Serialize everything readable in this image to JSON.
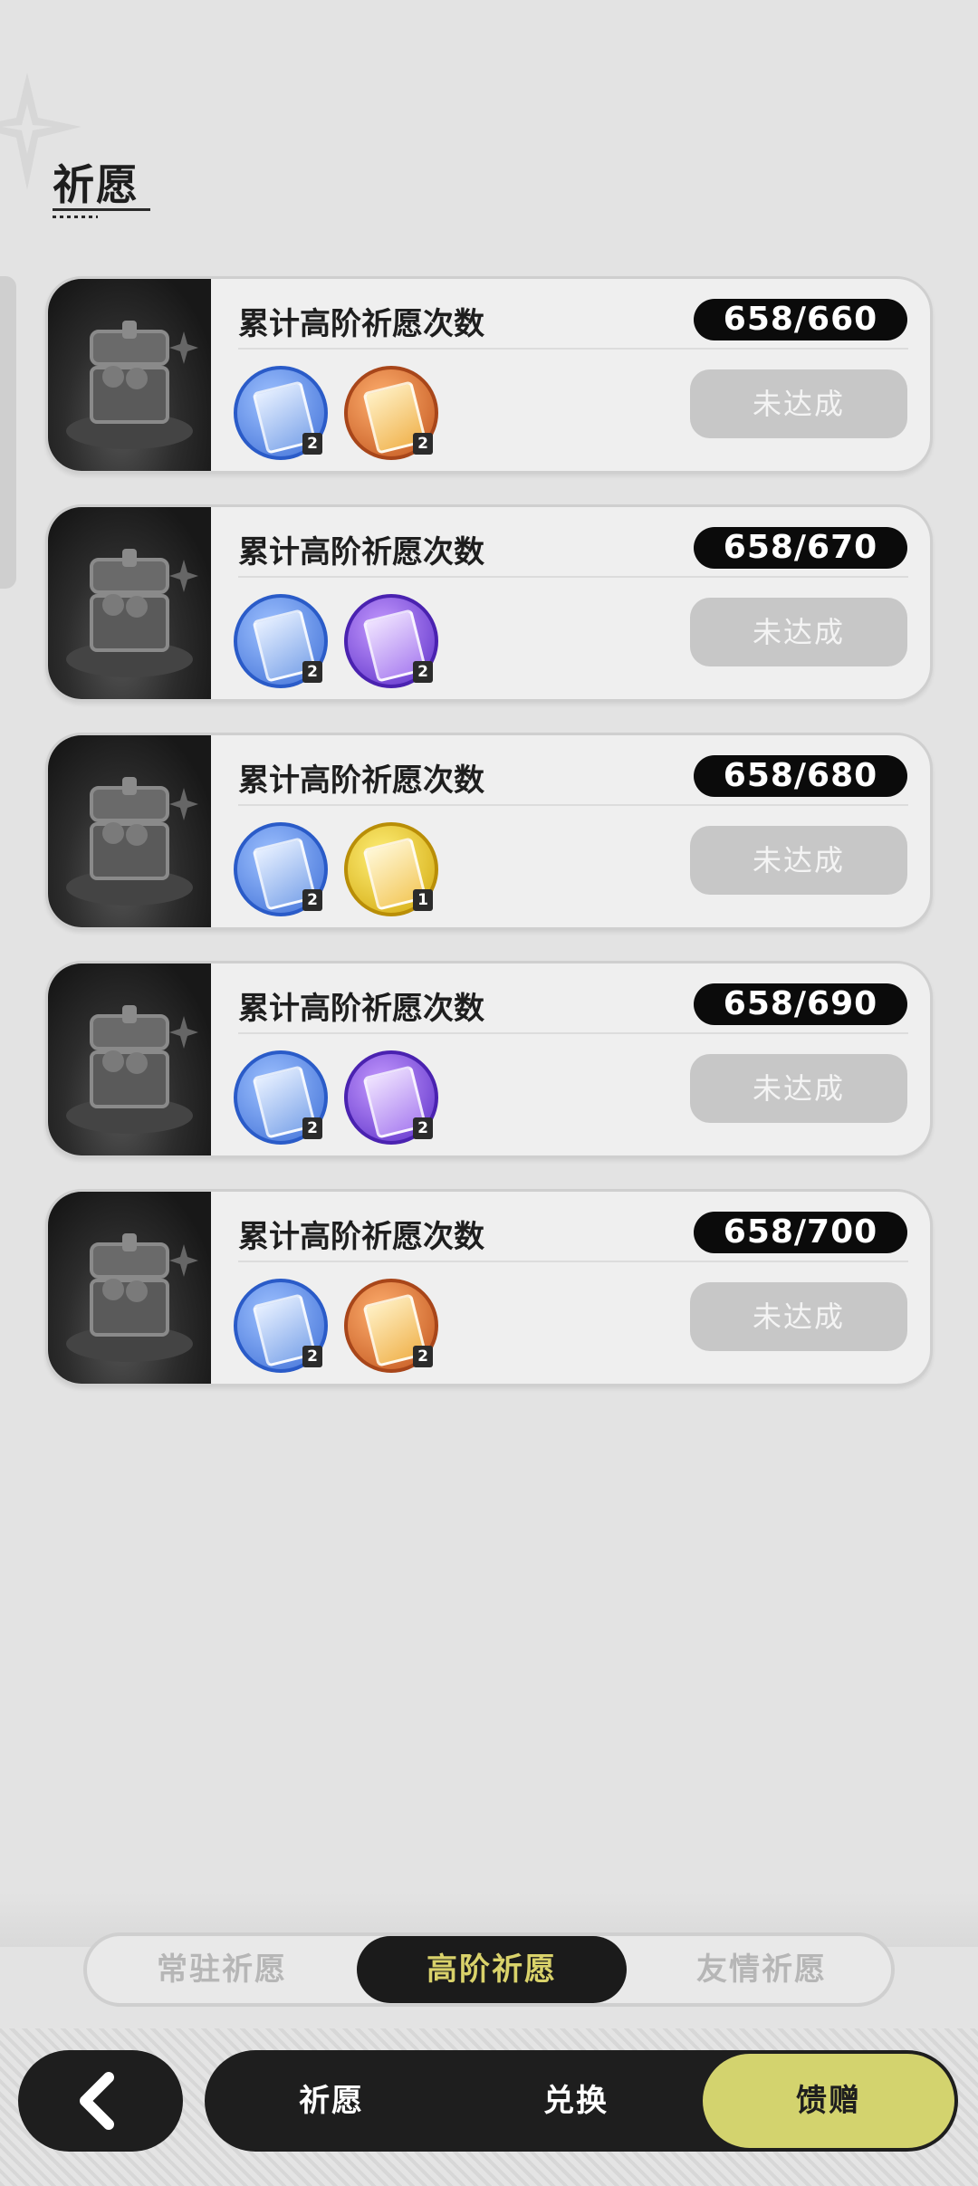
{
  "header": {
    "title": "祈愿"
  },
  "milestones": [
    {
      "title": "累计高阶祈愿次数",
      "progress": "658/660",
      "status": "未达成",
      "rewards": [
        {
          "icon": "blue-card-icon",
          "color": "#3f6fd6",
          "count": "2"
        },
        {
          "icon": "orange-card-icon",
          "color": "#c0531b",
          "count": "2"
        }
      ]
    },
    {
      "title": "累计高阶祈愿次数",
      "progress": "658/670",
      "status": "未达成",
      "rewards": [
        {
          "icon": "blue-card-icon",
          "color": "#3f6fd6",
          "count": "2"
        },
        {
          "icon": "purple-card-icon",
          "color": "#5a2ec7",
          "count": "2"
        }
      ]
    },
    {
      "title": "累计高阶祈愿次数",
      "progress": "658/680",
      "status": "未达成",
      "rewards": [
        {
          "icon": "blue-card-icon",
          "color": "#3f6fd6",
          "count": "2"
        },
        {
          "icon": "gold-card-icon",
          "color": "#d1a60a",
          "count": "1"
        }
      ]
    },
    {
      "title": "累计高阶祈愿次数",
      "progress": "658/690",
      "status": "未达成",
      "rewards": [
        {
          "icon": "blue-card-icon",
          "color": "#3f6fd6",
          "count": "2"
        },
        {
          "icon": "purple-card-icon",
          "color": "#5a2ec7",
          "count": "2"
        }
      ]
    },
    {
      "title": "累计高阶祈愿次数",
      "progress": "658/700",
      "status": "未达成",
      "rewards": [
        {
          "icon": "blue-card-icon",
          "color": "#3f6fd6",
          "count": "2"
        },
        {
          "icon": "orange-card-icon",
          "color": "#c0531b",
          "count": "2"
        }
      ]
    }
  ],
  "tabs": [
    {
      "label": "常驻祈愿",
      "active": false
    },
    {
      "label": "高阶祈愿",
      "active": true
    },
    {
      "label": "友情祈愿",
      "active": false
    }
  ],
  "bottom_nav": {
    "back_icon": "chevron-left-icon",
    "items": [
      {
        "label": "祈愿",
        "active": false
      },
      {
        "label": "兑换",
        "active": false
      },
      {
        "label": "馈赠",
        "active": true
      }
    ],
    "accent_color": "#d3d36e"
  }
}
